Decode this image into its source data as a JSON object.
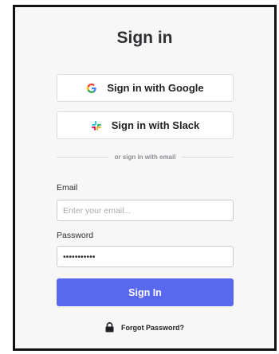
{
  "title": "Sign in",
  "oauth": {
    "google_label": "Sign in with Google",
    "google_icon": "google-g-icon",
    "slack_label": "Sign in with Slack",
    "slack_icon": "slack-icon"
  },
  "divider_text": "or sign in with email",
  "form": {
    "email_label": "Email",
    "email_placeholder": "Enter your email...",
    "email_value": "",
    "password_label": "Password",
    "password_value": "•••••••••••",
    "submit_label": "Sign In"
  },
  "forgot": {
    "label": "Forgot Password?",
    "icon": "lock-icon"
  },
  "colors": {
    "accent": "#5a68f0",
    "background": "#f7f7f8",
    "border": "#111111"
  }
}
